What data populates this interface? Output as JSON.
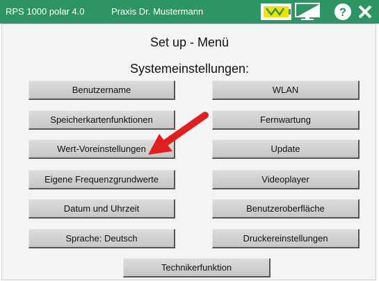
{
  "titlebar": {
    "app_name": "RPS 1000 polar 4.0",
    "practice": "Praxis Dr. Mustermann",
    "icons": [
      "battery-icon",
      "monitor-icon",
      "help-icon",
      "close-icon"
    ],
    "help_glyph": "?",
    "close_glyph": "✕"
  },
  "page": {
    "title": "Set up - Menü",
    "section": "Systemeinstellungen:"
  },
  "buttons": {
    "benutzername": "Benutzername",
    "wlan": "WLAN",
    "speicherkarten": "Speicherkartenfunktionen",
    "fernwartung": "Fernwartung",
    "wert_voreinstellungen": "Wert-Voreinstellungen",
    "update": "Update",
    "frequenz": "Eigene Frequenzgrundwerte",
    "videoplayer": "Videoplayer",
    "datum": "Datum und Uhrzeit",
    "oberflaeche": "Benutzeroberfläche",
    "sprache": "Sprache: Deutsch",
    "drucker": "Druckereinstellungen",
    "techniker": "Technikerfunktion"
  },
  "colors": {
    "titlebar": "#2d9463",
    "arrow": "#e0201f",
    "battery": "#f2e200"
  }
}
